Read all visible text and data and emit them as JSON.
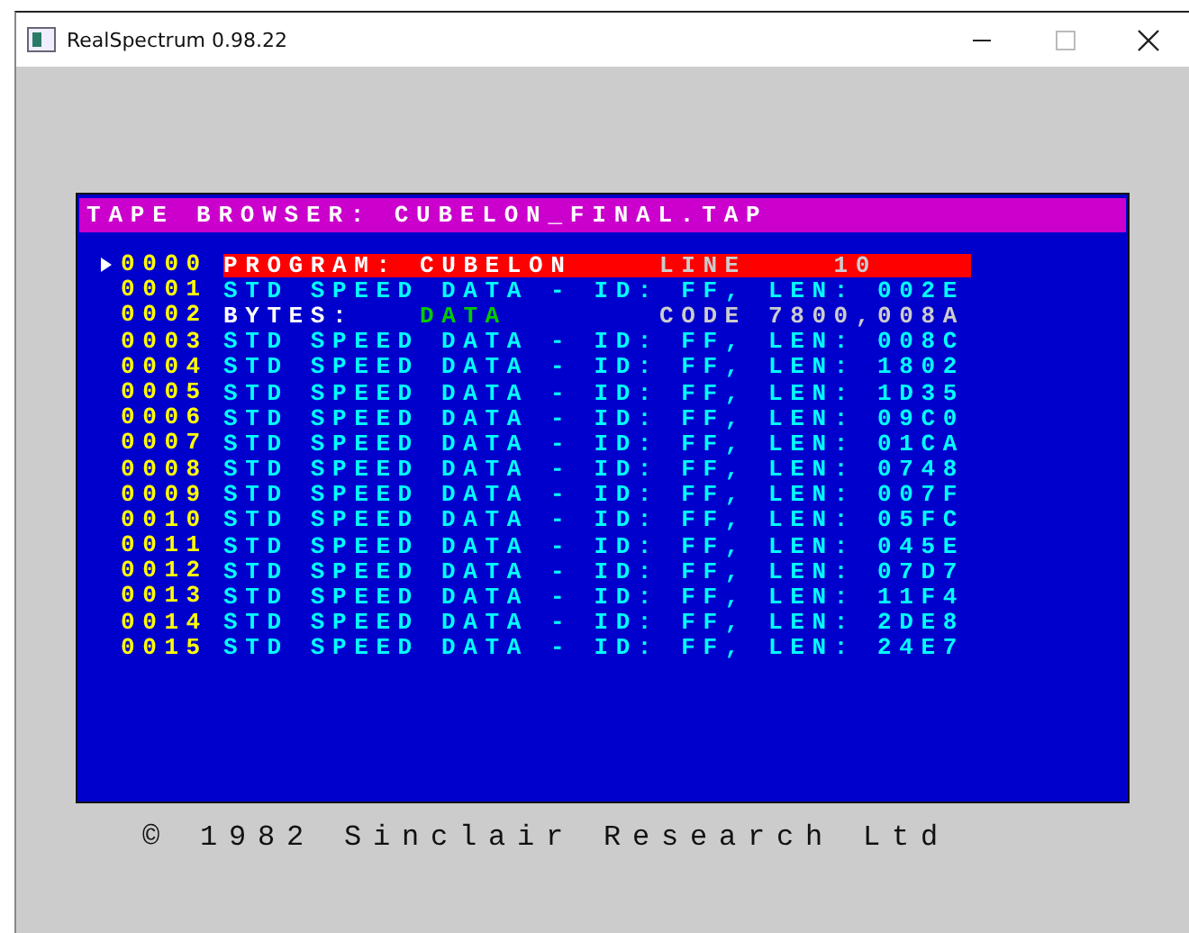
{
  "window": {
    "title": "RealSpectrum 0.98.22"
  },
  "browser": {
    "title": "TAPE BROWSER: CUBELON_FINAL.TAP",
    "rows": [
      {
        "number": "0000",
        "selected": true,
        "kind": "program",
        "type_label": "PROGRAM:",
        "name": "CUBELON",
        "info": "LINE    10"
      },
      {
        "number": "0001",
        "selected": false,
        "kind": "data",
        "text": "STD SPEED DATA - ID: FF, LEN: 002E"
      },
      {
        "number": "0002",
        "selected": false,
        "kind": "bytes",
        "type_label": "BYTES:",
        "name": "DATA",
        "info": "CODE 7800,008A"
      },
      {
        "number": "0003",
        "selected": false,
        "kind": "data",
        "text": "STD SPEED DATA - ID: FF, LEN: 008C"
      },
      {
        "number": "0004",
        "selected": false,
        "kind": "data",
        "text": "STD SPEED DATA - ID: FF, LEN: 1802"
      },
      {
        "number": "0005",
        "selected": false,
        "kind": "data",
        "text": "STD SPEED DATA - ID: FF, LEN: 1D35"
      },
      {
        "number": "0006",
        "selected": false,
        "kind": "data",
        "text": "STD SPEED DATA - ID: FF, LEN: 09C0"
      },
      {
        "number": "0007",
        "selected": false,
        "kind": "data",
        "text": "STD SPEED DATA - ID: FF, LEN: 01CA"
      },
      {
        "number": "0008",
        "selected": false,
        "kind": "data",
        "text": "STD SPEED DATA - ID: FF, LEN: 0748"
      },
      {
        "number": "0009",
        "selected": false,
        "kind": "data",
        "text": "STD SPEED DATA - ID: FF, LEN: 007F"
      },
      {
        "number": "0010",
        "selected": false,
        "kind": "data",
        "text": "STD SPEED DATA - ID: FF, LEN: 05FC"
      },
      {
        "number": "0011",
        "selected": false,
        "kind": "data",
        "text": "STD SPEED DATA - ID: FF, LEN: 045E"
      },
      {
        "number": "0012",
        "selected": false,
        "kind": "data",
        "text": "STD SPEED DATA - ID: FF, LEN: 07D7"
      },
      {
        "number": "0013",
        "selected": false,
        "kind": "data",
        "text": "STD SPEED DATA - ID: FF, LEN: 11F4"
      },
      {
        "number": "0014",
        "selected": false,
        "kind": "data",
        "text": "STD SPEED DATA - ID: FF, LEN: 2DE8"
      },
      {
        "number": "0015",
        "selected": false,
        "kind": "data",
        "text": "STD SPEED DATA - ID: FF, LEN: 24E7"
      }
    ]
  },
  "copyright": "© 1982 Sinclair Research Ltd"
}
